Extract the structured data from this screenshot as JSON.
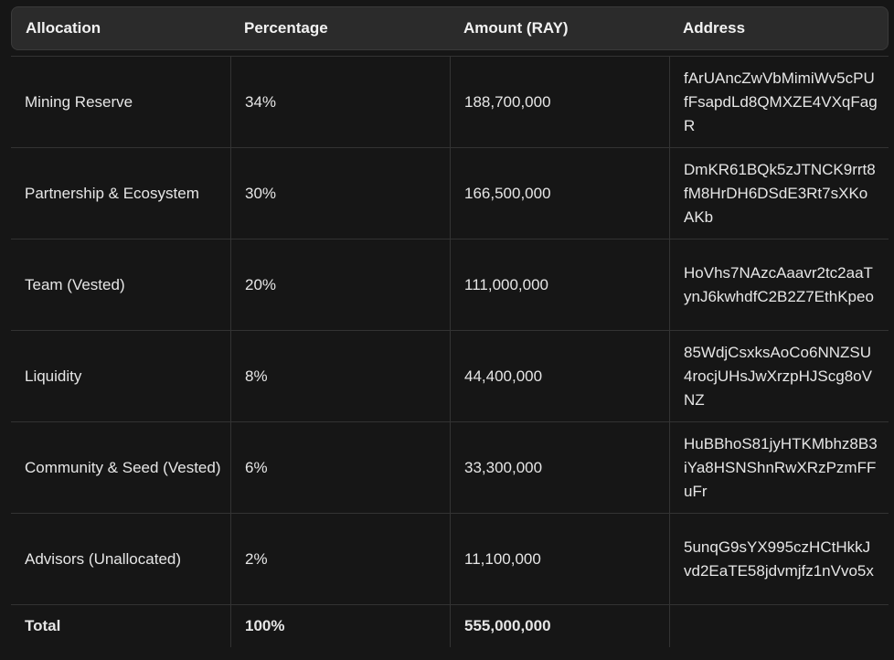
{
  "table": {
    "headers": [
      "Allocation",
      "Percentage",
      "Amount (RAY)",
      "Address"
    ],
    "rows": [
      {
        "allocation": "Mining Reserve",
        "percentage": "34%",
        "amount": "188,700,000",
        "address": "fArUAncZwVbMimiWv5cPUfFsapdLd8QMXZE4VXqFagR"
      },
      {
        "allocation": "Partnership & Ecosystem",
        "percentage": "30%",
        "amount": "166,500,000",
        "address": "DmKR61BQk5zJTNCK9rrt8fM8HrDH6DSdE3Rt7sXKoAKb"
      },
      {
        "allocation": "Team (Vested)",
        "percentage": "20%",
        "amount": "111,000,000",
        "address": "HoVhs7NAzcAaavr2tc2aaTynJ6kwhdfC2B2Z7EthKpeo"
      },
      {
        "allocation": "Liquidity",
        "percentage": "8%",
        "amount": "44,400,000",
        "address": "85WdjCsxksAoCo6NNZSU4rocjUHsJwXrzpHJScg8oVNZ"
      },
      {
        "allocation": "Community & Seed (Vested)",
        "percentage": "6%",
        "amount": "33,300,000",
        "address": "HuBBhoS81jyHTKMbhz8B3iYa8HSNShnRwXRzPzmFFuFr"
      },
      {
        "allocation": "Advisors (Unallocated)",
        "percentage": "2%",
        "amount": "11,100,000",
        "address": "5unqG9sYX995czHCtHkkJvd2EaTE58jdvmjfz1nVvo5x"
      }
    ],
    "total": {
      "label": "Total",
      "percentage": "100%",
      "amount": "555,000,000",
      "address": ""
    }
  }
}
